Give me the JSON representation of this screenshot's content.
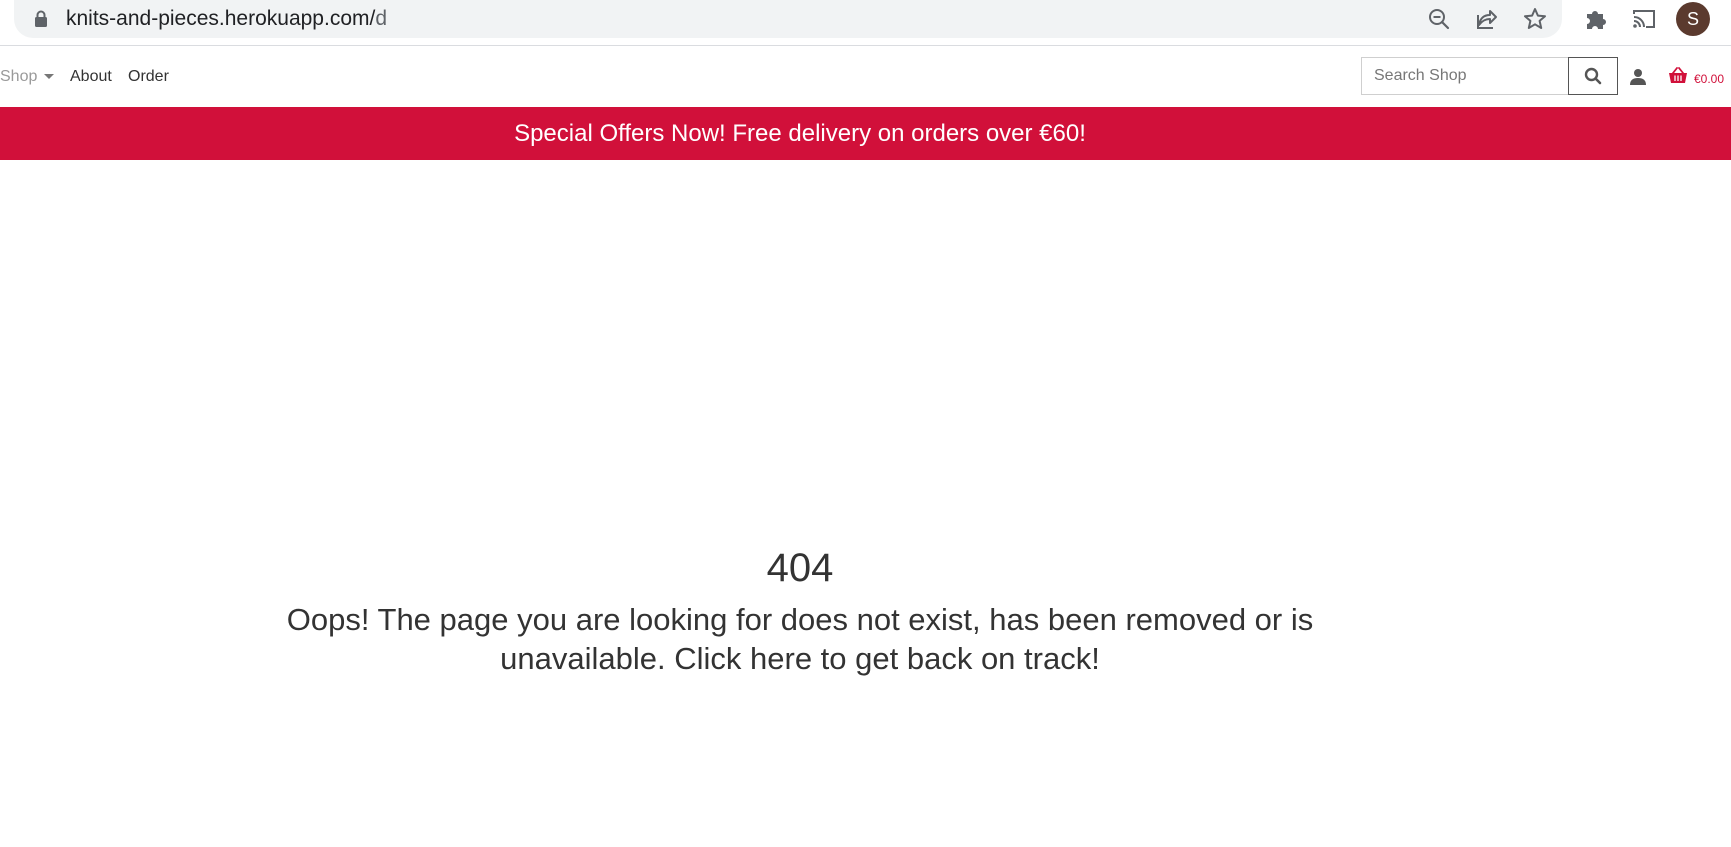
{
  "browser": {
    "url_host": "knits-and-pieces.herokuapp.com/",
    "url_path": "d",
    "profile_initial": "S"
  },
  "nav": {
    "shop_label": "Shop",
    "about_label": "About",
    "order_label": "Order",
    "search_placeholder": "Search Shop",
    "cart_total": "€0.00"
  },
  "banner": {
    "text": "Special Offers Now! Free delivery on orders over €60!"
  },
  "error": {
    "code": "404",
    "message": "Oops! The page you are looking for does not exist, has been removed or is unavailable. Click here to get back on track!"
  },
  "colors": {
    "brand_red": "#d1103a",
    "text": "#333333",
    "avatar": "#5b3a2e"
  }
}
